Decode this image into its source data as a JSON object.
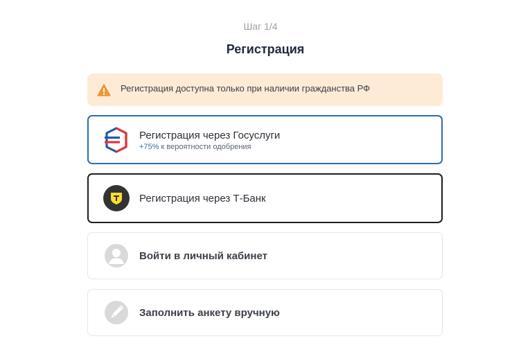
{
  "header": {
    "step": "Шаг 1/4",
    "title": "Регистрация"
  },
  "warning": {
    "icon": "warning-triangle-icon",
    "text": "Регистрация доступна только при наличии гражданства РФ",
    "background": "#fdebd6",
    "icon_color": "#f0953a"
  },
  "options": [
    {
      "icon": "gosuslugi-logo",
      "label": "Регистрация через Госуслуги",
      "sub_accent": "+75%",
      "sub_text": " к вероятности одобрения",
      "border_color": "#2b6cb0"
    },
    {
      "icon": "tbank-logo",
      "label": "Регистрация через Т-Банк",
      "border_color": "#1c1c1c"
    },
    {
      "icon": "user-icon",
      "label": "Войти в личный кабинет"
    },
    {
      "icon": "pencil-icon",
      "label": "Заполнить анкету вручную"
    }
  ]
}
